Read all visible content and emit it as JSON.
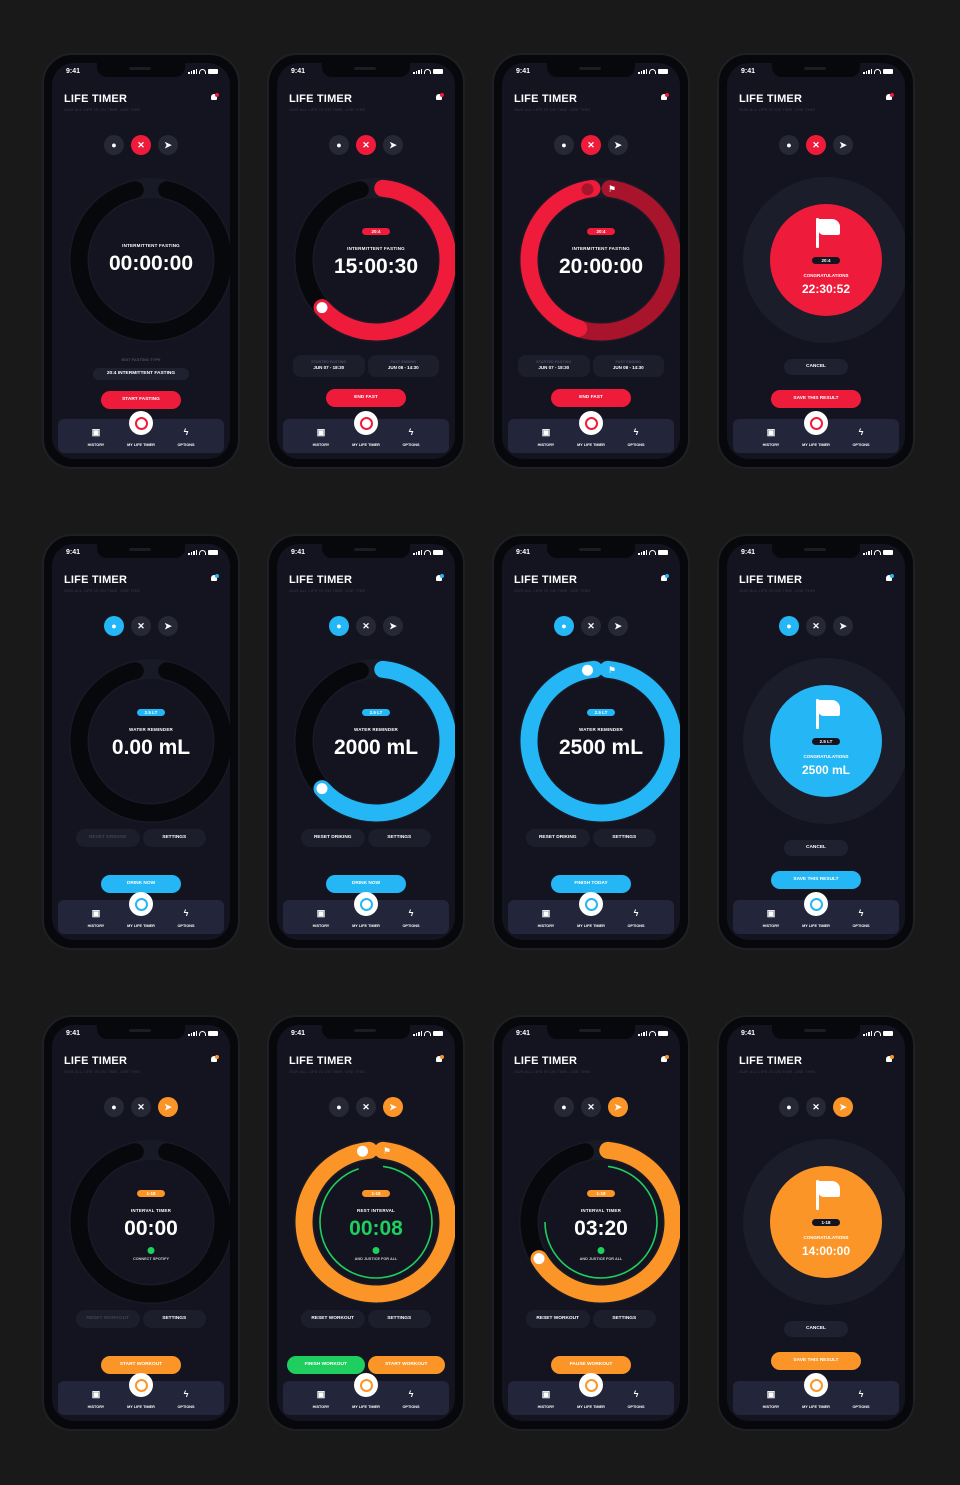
{
  "colors": {
    "red": "#ef1b3a",
    "red_dark": "#a8142b",
    "blue": "#25b6f5",
    "orange": "#fb9527",
    "green": "#1ecf5f",
    "bg": "#191919",
    "screen": "#13141f"
  },
  "app": {
    "title": "LIFE TIMER",
    "subtitle": "OUR ALL LIFE IS ON TIME, USE THIS"
  },
  "status": {
    "time": "9:41"
  },
  "tabs": {
    "history": "HISTORY",
    "center": "MY LIFE TIMER",
    "options": "OPTIONS"
  },
  "mode_icons": [
    "drop-icon",
    "fork-knife-icon",
    "runner-icon"
  ],
  "screens": [
    {
      "theme": "red",
      "active_mode": 1,
      "state": "ring",
      "progress": 0,
      "pill": "",
      "label": "INTERMITTENT FASTING",
      "value": "00:00:00",
      "extra": "edit",
      "edit_label": "EDIT FASTING TYPE",
      "type_value": "20:4 INTERMITTENT FASTING",
      "button": "START FASTING"
    },
    {
      "theme": "red",
      "active_mode": 1,
      "state": "ring",
      "progress": 0.62,
      "pill": "20:4",
      "label": "INTERMITTENT FASTING",
      "value": "15:00:30",
      "extra": "info",
      "info": [
        {
          "k": "STARTED FASTING",
          "v": "JUN 07 - 18:30"
        },
        {
          "k": "FAST ENDING",
          "v": "JUN 08 - 14:30"
        }
      ],
      "button": "END FAST"
    },
    {
      "theme": "red",
      "active_mode": 1,
      "state": "ring-full",
      "progress": 1,
      "pill": "20:4",
      "label": "INTERMITTENT FASTING",
      "value": "20:00:00",
      "extra": "info",
      "info": [
        {
          "k": "STARTED FASTING",
          "v": "JUN 07 - 18:30"
        },
        {
          "k": "FAST ENDING",
          "v": "JUN 08 - 14:30"
        }
      ],
      "button": "END FAST"
    },
    {
      "theme": "red",
      "active_mode": 1,
      "state": "done",
      "pill": "20:4",
      "label": "CONGRATULATIONS",
      "value": "22:30:52",
      "cancel": "CANCEL",
      "button": "SAVE THIS RESULT"
    },
    {
      "theme": "blue",
      "active_mode": 0,
      "state": "ring",
      "progress": 0,
      "pill": "2.5 LT",
      "label": "WATER REMINDER",
      "value": "0.00 mL",
      "seg": [
        "RESET DRIKING",
        "SETTINGS"
      ],
      "seg_dim": true,
      "button": "DRINK NOW"
    },
    {
      "theme": "blue",
      "active_mode": 0,
      "state": "ring",
      "progress": 0.62,
      "pill": "2.5 LT",
      "label": "WATER REMINDER",
      "value": "2000 mL",
      "seg": [
        "RESET DRIKING",
        "SETTINGS"
      ],
      "seg_dim": false,
      "button": "DRINK NOW"
    },
    {
      "theme": "blue",
      "active_mode": 0,
      "state": "ring",
      "progress": 1,
      "pill": "2.5 LT",
      "label": "WATER REMINDER",
      "value": "2500 mL",
      "seg": [
        "RESET DRIKING",
        "SETTINGS"
      ],
      "seg_dim": false,
      "button": "FINISH TODAY"
    },
    {
      "theme": "blue",
      "active_mode": 0,
      "state": "done",
      "pill": "2.5 LT",
      "label": "CONGRATULATIONS",
      "value": "2500 mL",
      "cancel": "CANCEL",
      "button": "SAVE THIS RESULT"
    },
    {
      "theme": "orange",
      "active_mode": 2,
      "state": "ring",
      "progress": 0,
      "pill": "1-18",
      "label": "INTERVAL TIMER",
      "value": "00:00",
      "sub": "CONNECT SPOTIFY",
      "seg": [
        "RESET WORKOUT",
        "SETTINGS"
      ],
      "seg_dim": true,
      "button": "START WORKOUT"
    },
    {
      "theme": "orange",
      "active_mode": 2,
      "state": "ring",
      "progress": 1,
      "inner": 0.95,
      "pill": "1-18",
      "label": "REST INTERVAL",
      "value": "00:08",
      "value_green": true,
      "sub": "AND JUSTICE FOR ALL",
      "seg": [
        "RESET WORKOUT",
        "SETTINGS"
      ],
      "seg_dim": false,
      "two": [
        "FINISH WORKOUT",
        "START WORKOUT"
      ]
    },
    {
      "theme": "orange",
      "active_mode": 2,
      "state": "ring",
      "progress": 0.65,
      "inner": 0.75,
      "pill": "1-18",
      "label": "INTERVAL TIMER",
      "value": "03:20",
      "sub": "AND JUSTICE FOR ALL",
      "seg": [
        "RESET WORKOUT",
        "SETTINGS"
      ],
      "seg_dim": false,
      "button": "PAUSE WORKOUT"
    },
    {
      "theme": "orange",
      "active_mode": 2,
      "state": "done",
      "pill": "1-18",
      "label": "CONGRATULATIONS",
      "value": "14:00:00",
      "cancel": "CANCEL",
      "button": "SAVE THIS RESULT"
    }
  ]
}
